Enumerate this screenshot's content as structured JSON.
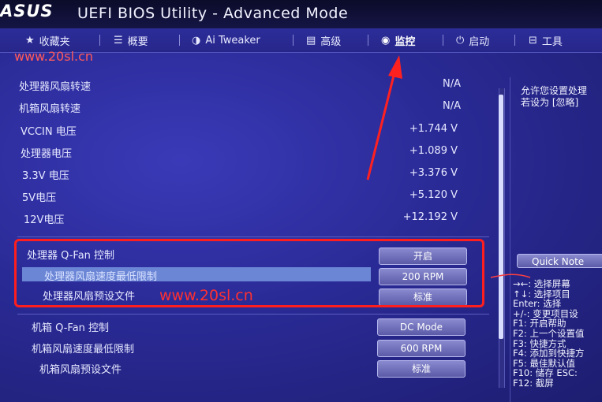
{
  "header": {
    "logo": "ASUS",
    "title": "UEFI BIOS Utility - Advanced Mode"
  },
  "nav": {
    "items": [
      {
        "icon": "★",
        "label": "收藏夹"
      },
      {
        "icon": "☰",
        "label": "概要"
      },
      {
        "icon": "◑",
        "label": "Ai Tweaker"
      },
      {
        "icon": "▤",
        "label": "高级"
      },
      {
        "icon": "◉",
        "label": "监控"
      },
      {
        "icon": "⏻",
        "label": "启动"
      },
      {
        "icon": "⊟",
        "label": "工具"
      }
    ]
  },
  "watermark": "www.20sl.cn",
  "monitor": {
    "rows": [
      {
        "label": "处理器风扇转速",
        "value": "N/A"
      },
      {
        "label": "机箱风扇转速",
        "value": "N/A"
      },
      {
        "label": "VCCIN 电压",
        "value": "+1.744 V"
      },
      {
        "label": "处理器电压",
        "value": "+1.089 V"
      },
      {
        "label": "3.3V 电压",
        "value": "+3.376 V"
      },
      {
        "label": "5V电压",
        "value": "+5.120 V"
      },
      {
        "label": "12V电压",
        "value": "+12.192 V"
      }
    ]
  },
  "qfan": {
    "cpu_qfan_label": "处理器 Q-Fan 控制",
    "cpu_qfan_value": "开启",
    "cpu_fan_lower_limit_label": "处理器风扇速度最低限制",
    "cpu_fan_lower_limit_value": "200 RPM",
    "cpu_fan_profile_label": "处理器风扇预设文件",
    "cpu_fan_profile_value": "标准",
    "chassis_qfan_label": "机箱 Q-Fan 控制",
    "chassis_qfan_value": "DC Mode",
    "chassis_fan_lower_limit_label": "机箱风扇速度最低限制",
    "chassis_fan_lower_limit_value": "600 RPM",
    "chassis_fan_profile_label": "机箱风扇预设文件",
    "chassis_fan_profile_value": "标准"
  },
  "help": {
    "line1": "允许您设置处理",
    "line2": "若设为 [忽略]"
  },
  "quick_note": "Quick Note",
  "keys": [
    "→←: 选择屏幕",
    "↑↓: 选择项目",
    "Enter: 选择",
    "+/-: 变更项目设",
    "F1: 开启帮助",
    "F2: 上一个设置值",
    "F3: 快捷方式",
    "F4: 添加到快捷方",
    "F5: 最佳默认值",
    "F10: 储存  ESC:",
    "F12: 截屏"
  ],
  "colors": {
    "background": "#2a2a96",
    "annotation_red": "#ff1e1e",
    "highlight": "#6c86d6"
  }
}
